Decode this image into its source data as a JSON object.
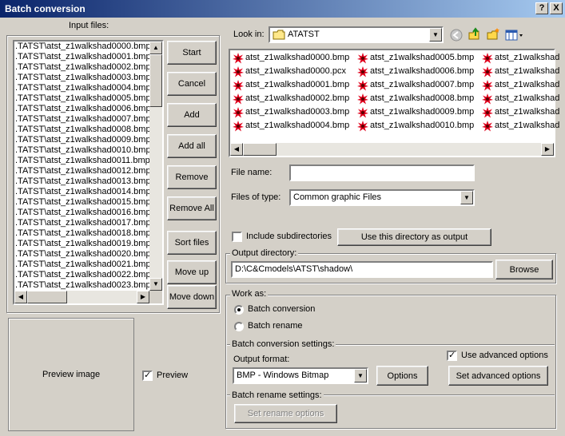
{
  "window": {
    "title": "Batch conversion",
    "help_label": "?",
    "close_label": "X"
  },
  "input_files": {
    "label": "Input files:",
    "items": [
      ".TATST\\atst_z1walkshad0000.bmp",
      ".TATST\\atst_z1walkshad0001.bmp",
      ".TATST\\atst_z1walkshad0002.bmp",
      ".TATST\\atst_z1walkshad0003.bmp",
      ".TATST\\atst_z1walkshad0004.bmp",
      ".TATST\\atst_z1walkshad0005.bmp",
      ".TATST\\atst_z1walkshad0006.bmp",
      ".TATST\\atst_z1walkshad0007.bmp",
      ".TATST\\atst_z1walkshad0008.bmp",
      ".TATST\\atst_z1walkshad0009.bmp",
      ".TATST\\atst_z1walkshad0010.bmp",
      ".TATST\\atst_z1walkshad0011.bmp",
      ".TATST\\atst_z1walkshad0012.bmp",
      ".TATST\\atst_z1walkshad0013.bmp",
      ".TATST\\atst_z1walkshad0014.bmp",
      ".TATST\\atst_z1walkshad0015.bmp",
      ".TATST\\atst_z1walkshad0016.bmp",
      ".TATST\\atst_z1walkshad0017.bmp",
      ".TATST\\atst_z1walkshad0018.bmp",
      ".TATST\\atst_z1walkshad0019.bmp",
      ".TATST\\atst_z1walkshad0020.bmp",
      ".TATST\\atst_z1walkshad0021.bmp",
      ".TATST\\atst_z1walkshad0022.bmp",
      ".TATST\\atst_z1walkshad0023.bmp"
    ]
  },
  "buttons": {
    "start": "Start",
    "cancel": "Cancel",
    "add": "Add",
    "add_all": "Add all",
    "remove": "Remove",
    "remove_all": "Remove All",
    "sort_files": "Sort files",
    "move_up": "Move up",
    "move_down": "Move down"
  },
  "preview": {
    "image_label": "Preview image",
    "checkbox_label": "Preview",
    "checked": true
  },
  "browser": {
    "look_in_label": "Look in:",
    "look_in_value": "ATATST",
    "files_col1": [
      "atst_z1walkshad0000.bmp",
      "atst_z1walkshad0000.pcx",
      "atst_z1walkshad0001.bmp",
      "atst_z1walkshad0002.bmp",
      "atst_z1walkshad0003.bmp",
      "atst_z1walkshad0004.bmp"
    ],
    "files_col2": [
      "atst_z1walkshad0005.bmp",
      "atst_z1walkshad0006.bmp",
      "atst_z1walkshad0007.bmp",
      "atst_z1walkshad0008.bmp",
      "atst_z1walkshad0009.bmp",
      "atst_z1walkshad0010.bmp"
    ],
    "files_col3": [
      "atst_z1walkshad",
      "atst_z1walkshad",
      "atst_z1walkshad",
      "atst_z1walkshad",
      "atst_z1walkshad",
      "atst_z1walkshad"
    ],
    "file_name_label": "File name:",
    "file_name_value": "",
    "files_of_type_label": "Files of type:",
    "files_of_type_value": "Common graphic Files",
    "include_subdirs_label": "Include subdirectories",
    "include_subdirs_checked": false,
    "use_dir_button": "Use this directory as output"
  },
  "output": {
    "label": "Output directory:",
    "value": "D:\\C&Cmodels\\ATST\\shadow\\",
    "browse_button": "Browse"
  },
  "work_as": {
    "label": "Work as:",
    "options": [
      "Batch conversion",
      "Batch rename"
    ],
    "selected": "Batch conversion",
    "conversion_settings_label": "Batch conversion settings:",
    "output_format_label": "Output format:",
    "output_format_value": "BMP - Windows Bitmap",
    "options_button": "Options",
    "use_advanced_label": "Use advanced options",
    "use_advanced_checked": true,
    "set_advanced_button": "Set advanced options",
    "rename_settings_label": "Batch rename settings:",
    "set_rename_button": "Set rename options"
  },
  "colors": {
    "face": "#d4d0c8",
    "title_start": "#0a246a",
    "title_end": "#a6caf0",
    "icon_red": "#e0001c"
  }
}
